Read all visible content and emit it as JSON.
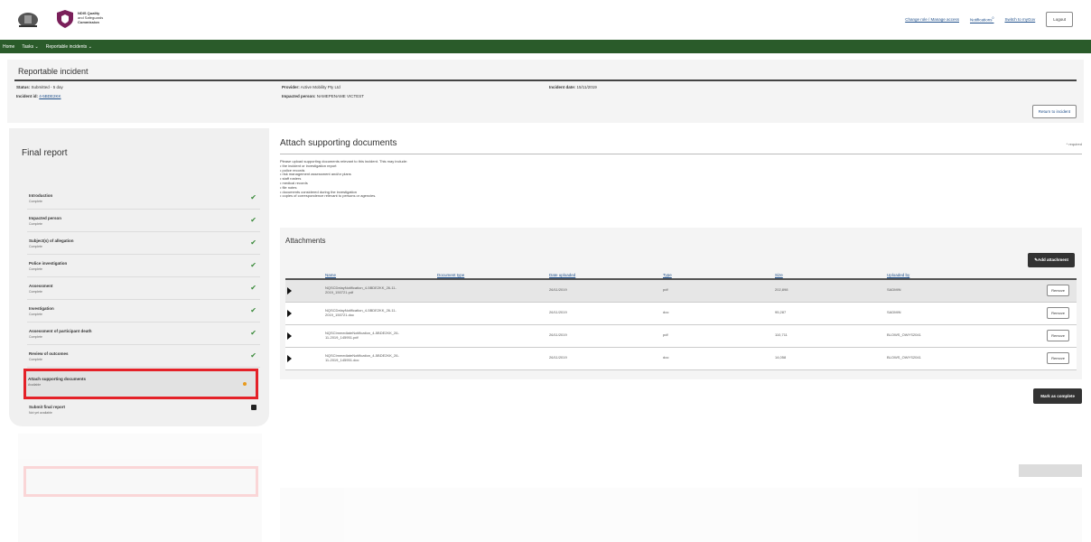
{
  "header": {
    "logo_text_line1": "NDIS Quality",
    "logo_text_line2": "and Safeguards",
    "logo_text_line3": "Commission",
    "links": [
      "Change role / Manage access",
      "Notifications",
      "Switch to myGov"
    ],
    "notification_count": "0",
    "logout_label": "Logout"
  },
  "nav": {
    "items": [
      "Home",
      "Tasks",
      "Reportable incidents"
    ]
  },
  "summary": {
    "title": "Reportable incident",
    "status_label": "Status:",
    "status_value": "Submitted - 5 day",
    "incident_id_label": "Incident id:",
    "incident_id_value": "4-5BDE2KK",
    "provider_label": "Provider:",
    "provider_value": "Active Mobility Pty Ltd",
    "impacted_label": "Impacted person:",
    "impacted_value": "NAMEPENAME VICTEST",
    "incident_date_label": "Incident date:",
    "incident_date_value": "15/11/2019",
    "return_label": "Return to incident"
  },
  "sidebar": {
    "title": "Final report",
    "items": [
      {
        "label": "Introduction",
        "sub": "Complete",
        "status": "complete"
      },
      {
        "label": "Impacted person",
        "sub": "Complete",
        "status": "complete"
      },
      {
        "label": "Subject(s) of allegation",
        "sub": "Complete",
        "status": "complete"
      },
      {
        "label": "Police investigation",
        "sub": "Complete",
        "status": "complete"
      },
      {
        "label": "Assessment",
        "sub": "Complete",
        "status": "complete"
      },
      {
        "label": "Investigation",
        "sub": "Complete",
        "status": "complete"
      },
      {
        "label": "Assessment of participant death",
        "sub": "Complete",
        "status": "complete"
      },
      {
        "label": "Review of outcomes",
        "sub": "Complete",
        "status": "complete"
      },
      {
        "label": "Attach supporting documents",
        "sub": "Available",
        "status": "active"
      },
      {
        "label": "Submit final report",
        "sub": "Not yet available",
        "status": "locked"
      }
    ]
  },
  "main": {
    "title": "Attach supporting documents",
    "required_note": "* required",
    "intro_lines": [
      "Please upload supporting documents relevant to this incident. This may include:",
      "• the incident or investigation report",
      "• police records",
      "• risk management assessment and/or plans",
      "• staff rosters",
      "• medical records",
      "• file notes",
      "• documents considered during the investigation",
      "• copies of correspondence relevant to persons or agencies."
    ],
    "mark_complete_label": "Mark as complete"
  },
  "attachments": {
    "title": "Attachments",
    "add_label": "Add attachment",
    "columns": [
      "Name",
      "Document type",
      "Date uploaded",
      "Type",
      "Size",
      "Uploaded by"
    ],
    "remove_label": "Remove",
    "rows": [
      {
        "name_line1": "NQSCDelayNotification_4-5BDE2KK_26-11-",
        "name_line2": "2019_150721.pdf",
        "doc_type": "",
        "date": "26/11/2019",
        "type": "pdf",
        "size": "202,898",
        "uploaded_by": "SADMIN"
      },
      {
        "name_line1": "NQSCDelayNotification_4-5BDE2KK_26-11-",
        "name_line2": "2019_150721.doc",
        "doc_type": "",
        "date": "26/11/2019",
        "type": "doc",
        "size": "95,287",
        "uploaded_by": "SADMIN"
      },
      {
        "name_line1": "NQSCImmediateNotification_4-5BDE2KK_26-",
        "name_line2": "11-2019_145951.pdf",
        "doc_type": "",
        "date": "26/11/2019",
        "type": "pdf",
        "size": "110,711",
        "uploaded_by": "BLOWS_OWYS2041"
      },
      {
        "name_line1": "NQSCImmediateNotification_4-5BDE2KK_26-",
        "name_line2": "11-2019_145951.doc",
        "doc_type": "",
        "date": "26/11/2019",
        "type": "doc",
        "size": "14,058",
        "uploaded_by": "BLOWS_OWYS2041"
      }
    ]
  },
  "colors": {
    "nav_green": "#2a5b2a",
    "highlight_red": "#e42128",
    "link_blue": "#1f4f8a",
    "check_green": "#3a8a3a",
    "active_orange": "#e89a1c"
  }
}
